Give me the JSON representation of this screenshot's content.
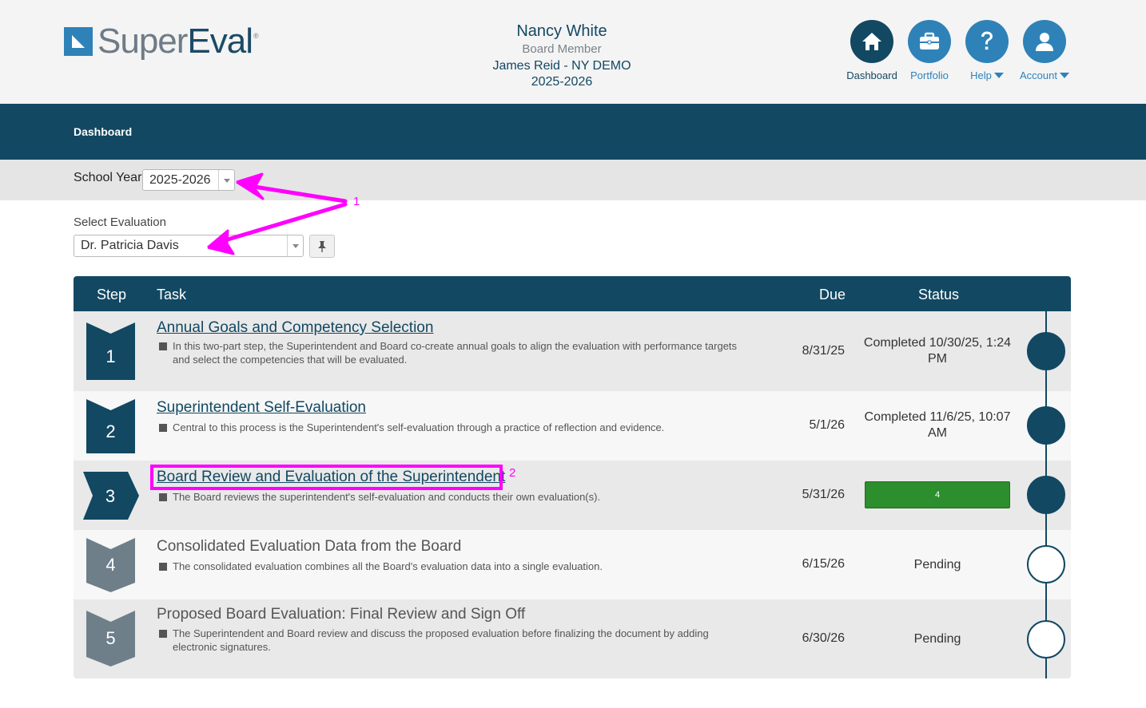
{
  "brand": {
    "name_part1": "Super",
    "name_part2": "Eval",
    "registered": "®"
  },
  "user": {
    "name": "Nancy White",
    "role": "Board Member",
    "district": "James Reid - NY DEMO",
    "year": "2025-2026"
  },
  "nav": {
    "dashboard": "Dashboard",
    "portfolio": "Portfolio",
    "help": "Help",
    "account": "Account"
  },
  "breadcrumb": "Dashboard",
  "school_year": {
    "label": "School Year:",
    "value": "2025-2026"
  },
  "evaluation": {
    "label": "Select Evaluation",
    "value": "Dr. Patricia Davis"
  },
  "annotations": {
    "one": "1",
    "two": "2"
  },
  "table": {
    "headers": {
      "step": "Step",
      "task": "Task",
      "due": "Due",
      "status": "Status"
    },
    "rows": [
      {
        "step": "1",
        "title": "Annual Goals and Competency Selection",
        "desc": "In this two-part step, the Superintendent and Board co-create annual goals to align the evaluation with performance targets and select the competencies that will be evaluated.",
        "due": "8/31/25",
        "status": "Completed 10/30/25, 1:24 PM",
        "state": "completed"
      },
      {
        "step": "2",
        "title": "Superintendent Self-Evaluation",
        "desc": "Central to this process is the Superintendent's self-evaluation through a practice of reflection and evidence.",
        "due": "5/1/26",
        "status": "Completed 11/6/25, 10:07 AM",
        "state": "completed"
      },
      {
        "step": "3",
        "title": "Board Review and Evaluation of the Superintendent",
        "desc": "The Board reviews the superintendent's self-evaluation and conducts their own evaluation(s).",
        "due": "5/31/26",
        "status": "4",
        "state": "current"
      },
      {
        "step": "4",
        "title": "Consolidated Evaluation Data from the Board",
        "desc": "The consolidated evaluation combines all the Board's evaluation data into a single evaluation.",
        "due": "6/15/26",
        "status": "Pending",
        "state": "pending"
      },
      {
        "step": "5",
        "title": "Proposed Board Evaluation: Final Review and Sign Off",
        "desc": "The Superintendent and Board review and discuss the proposed evaluation before finalizing the document by adding electronic signatures.",
        "due": "6/30/26",
        "status": "Pending",
        "state": "pending"
      }
    ]
  },
  "colors": {
    "brand_dark": "#124862",
    "brand_blue": "#2e82b8",
    "progress_green": "#2c8e2c",
    "annotation_magenta": "#ff00ff",
    "pending_badge": "#6e7f8a"
  },
  "icons": {
    "dashboard": "home-icon",
    "portfolio": "briefcase-icon",
    "help": "question-icon",
    "account": "user-icon",
    "pin": "pin-icon"
  }
}
